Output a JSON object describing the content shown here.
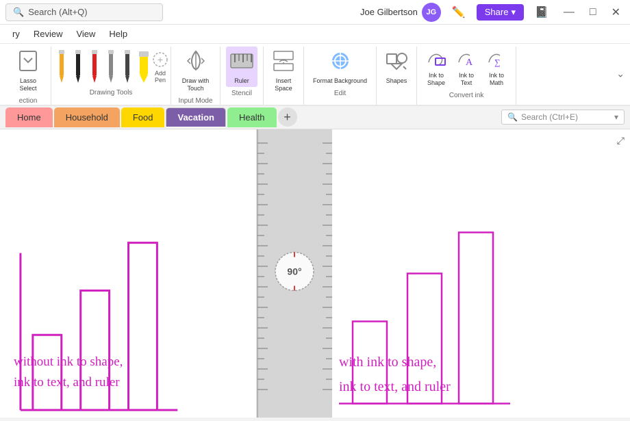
{
  "titlebar": {
    "search_placeholder": "Search (Alt+Q)",
    "user_name": "Joe Gilbertson",
    "avatar_initials": "JG",
    "pen_icon": "✏️",
    "minimize": "—",
    "maximize": "□",
    "close": "✕",
    "share_label": "Share"
  },
  "menubar": {
    "items": [
      "ry",
      "Review",
      "View",
      "Help"
    ]
  },
  "ribbon": {
    "lasso_label": "Lasso\nSelect",
    "drawing_tools_label": "Drawing Tools",
    "add_pen_label": "Add\nPen",
    "draw_with_touch_label": "Draw with\nTouch",
    "input_mode_label": "Input Mode",
    "ruler_label": "Ruler",
    "stencil_label": "Stencil",
    "insert_space_label": "Insert\nSpace",
    "format_background_label": "Format\nBackground",
    "edit_label": "Edit",
    "shapes_label": "Shapes",
    "ink_to_shape_label": "Ink to\nShape",
    "ink_to_text_label": "Ink to\nText",
    "ink_to_math_label": "Ink to\nMath",
    "convert_ink_label": "Convert ink"
  },
  "tabs": {
    "home_label": "Home",
    "household_label": "Household",
    "food_label": "Food",
    "vacation_label": "Vacation",
    "health_label": "Health",
    "add_label": "+",
    "search_placeholder": "Search (Ctrl+E)"
  },
  "canvas": {
    "left_text_line1": "without ink to shape,",
    "left_text_line2": "ink to text, and ruler",
    "right_text_line1": "with ink to shape,",
    "right_text_line2": "ink to text, and ruler",
    "ruler_degree": "90°"
  }
}
